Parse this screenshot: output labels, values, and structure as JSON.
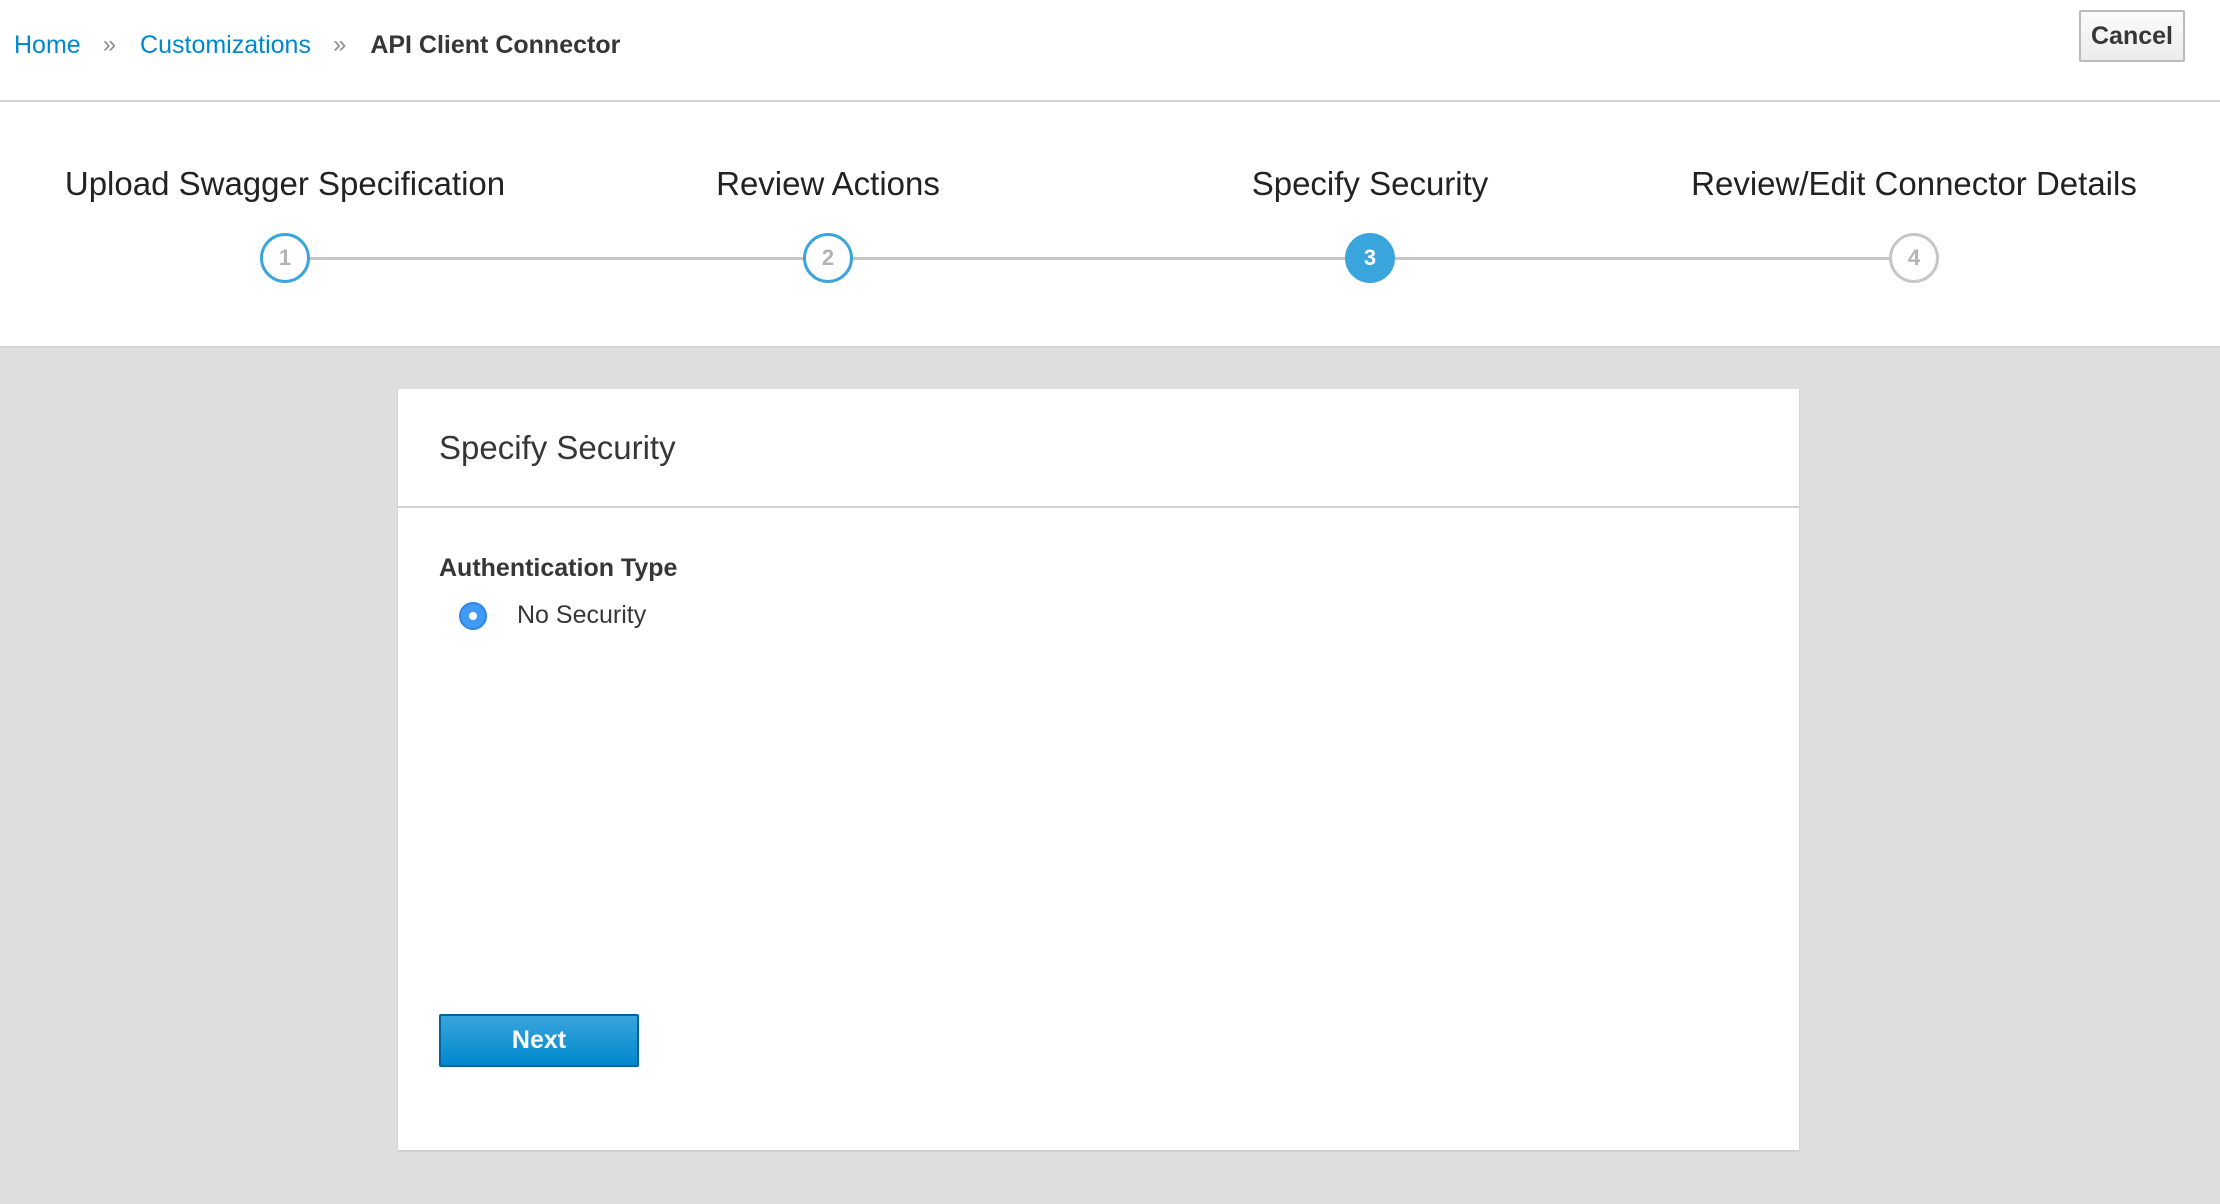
{
  "breadcrumb": {
    "items": [
      {
        "label": "Home"
      },
      {
        "label": "Customizations"
      },
      {
        "label": "API Client Connector"
      }
    ],
    "separator": "»"
  },
  "header": {
    "cancel_label": "Cancel"
  },
  "wizard": {
    "steps": [
      {
        "number": "1",
        "title": "Upload Swagger Specification",
        "state": "completed"
      },
      {
        "number": "2",
        "title": "Review Actions",
        "state": "completed"
      },
      {
        "number": "3",
        "title": "Specify Security",
        "state": "active"
      },
      {
        "number": "4",
        "title": "Review/Edit Connector Details",
        "state": "pending"
      }
    ],
    "active_color": "#39a5dc",
    "pending_color": "#c6c6c6"
  },
  "card": {
    "title": "Specify Security",
    "auth_label": "Authentication Type",
    "options": [
      {
        "label": "No Security",
        "selected": true
      }
    ],
    "next_label": "Next"
  },
  "colors": {
    "link": "#0088ce",
    "primary_button": "#0088ce",
    "background": "#dedede"
  }
}
